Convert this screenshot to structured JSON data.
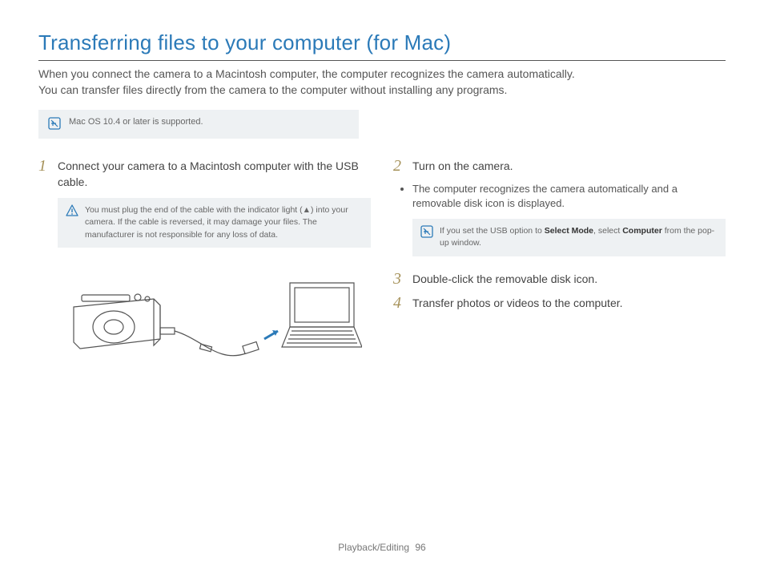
{
  "title": "Transferring files to your computer (for Mac)",
  "intro_line1": "When you connect the camera to a Macintosh computer, the computer recognizes the camera automatically.",
  "intro_line2": "You can transfer files directly from the camera to the computer without installing any programs.",
  "top_note": "Mac OS 10.4 or later is supported.",
  "left": {
    "step1_num": "1",
    "step1_text": "Connect your camera to a Macintosh computer with the USB cable.",
    "warn_text": "You must plug the end of the cable with the indicator light (▲) into your camera. If the cable is reversed, it may damage your files. The manufacturer is not responsible for any loss of data."
  },
  "right": {
    "step2_num": "2",
    "step2_text": "Turn on the camera.",
    "step2_bullet": "The computer recognizes the camera automatically and a removable disk icon is displayed.",
    "note_pre": "If you set the USB option to ",
    "note_b1": "Select Mode",
    "note_mid": ", select ",
    "note_b2": "Computer",
    "note_post": " from the pop-up window.",
    "step3_num": "3",
    "step3_text": "Double-click the removable disk icon.",
    "step4_num": "4",
    "step4_text": "Transfer photos or videos to the computer."
  },
  "footer": {
    "section": "Playback/Editing",
    "page": "96"
  }
}
